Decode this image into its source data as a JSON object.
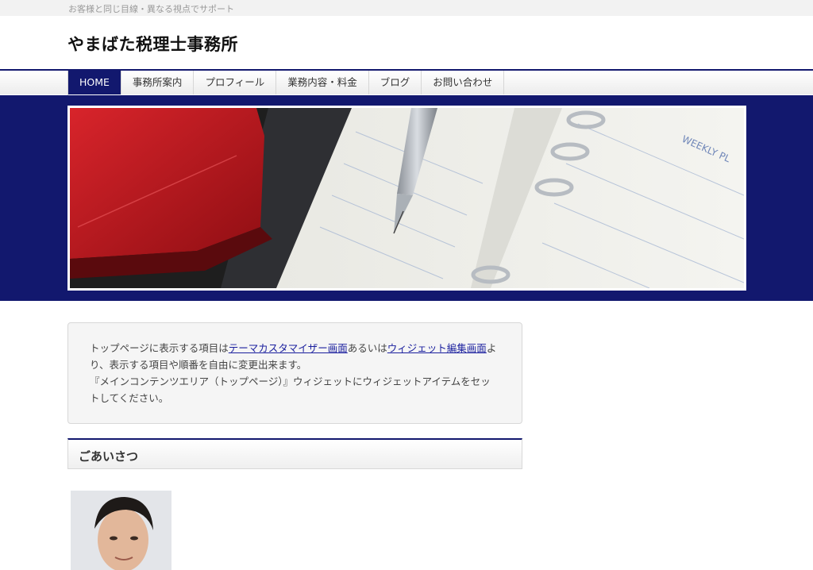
{
  "header": {
    "tagline": "お客様と同じ目線・異なる視点でサポート",
    "site_title": "やまばた税理士事務所"
  },
  "nav": {
    "items": [
      {
        "label": "HOME",
        "active": true
      },
      {
        "label": "事務所案内"
      },
      {
        "label": "プロフィール"
      },
      {
        "label": "業務内容・料金"
      },
      {
        "label": "ブログ"
      },
      {
        "label": "お問い合わせ"
      }
    ]
  },
  "hero": {
    "image": "planner-pen-red-wallet-photo",
    "planner_text": "WEEKLY PL"
  },
  "notice": {
    "text_1": "トップページに表示する項目は",
    "link_1": "テーマカスタマイザー画面",
    "text_2": "あるいは",
    "link_2": "ウィジェット編集画面",
    "text_3": "より、表示する項目や順番を自由に変更出来ます。",
    "text_4": "『メインコンテンツエリア（トップページ）』ウィジェットにウィジェットアイテムをセットしてください。"
  },
  "greeting": {
    "title": "ごあいさつ",
    "photo": "portrait-photo"
  },
  "colors": {
    "brand_navy": "#12186e",
    "link": "#1a1f9e"
  }
}
